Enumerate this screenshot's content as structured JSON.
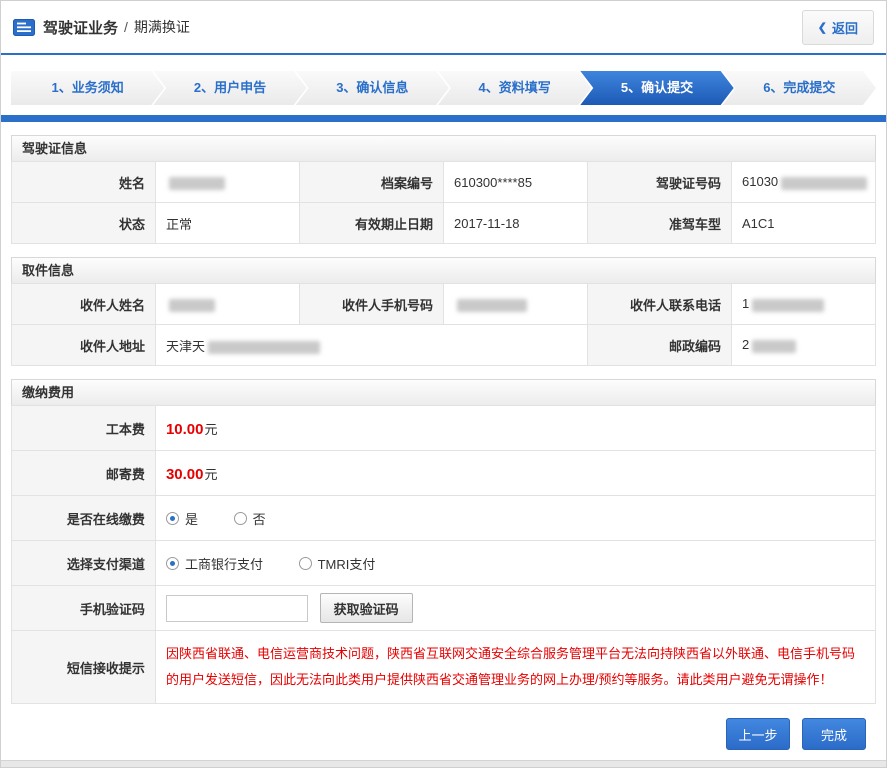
{
  "header": {
    "title_main": "驾驶证业务",
    "title_separator": "/",
    "title_sub": "期满换证",
    "back_chevron": "❮",
    "back_label": "返回"
  },
  "steps": {
    "active_index": 4,
    "items": [
      {
        "label": "1、业务须知"
      },
      {
        "label": "2、用户申告"
      },
      {
        "label": "3、确认信息"
      },
      {
        "label": "4、资料填写"
      },
      {
        "label": "5、确认提交"
      },
      {
        "label": "6、完成提交"
      }
    ]
  },
  "license_section": {
    "title": "驾驶证信息",
    "fields": {
      "name": {
        "label": "姓名",
        "value": "",
        "redacted": true
      },
      "file_number": {
        "label": "档案编号",
        "value": "610300****85"
      },
      "license_number": {
        "label": "驾驶证号码",
        "value": "61030",
        "redacted": true
      },
      "status": {
        "label": "状态",
        "value": "正常"
      },
      "valid_until": {
        "label": "有效期止日期",
        "value": "2017-11-18"
      },
      "vehicle_class": {
        "label": "准驾车型",
        "value": "A1C1"
      }
    }
  },
  "pickup_section": {
    "title": "取件信息",
    "fields": {
      "recipient_name": {
        "label": "收件人姓名",
        "value": "",
        "redacted": true
      },
      "recipient_mobile": {
        "label": "收件人手机号码",
        "value": "",
        "redacted": true
      },
      "recipient_phone": {
        "label": "收件人联系电话",
        "value": "1",
        "redacted": true
      },
      "recipient_address": {
        "label": "收件人地址",
        "value": "天津天",
        "redacted": true
      },
      "postal_code": {
        "label": "邮政编码",
        "value": "2",
        "redacted": true
      }
    }
  },
  "fee_section": {
    "title": "缴纳费用",
    "production_fee": {
      "label": "工本费",
      "amount": "10.00",
      "unit": "元"
    },
    "mailing_fee": {
      "label": "邮寄费",
      "amount": "30.00",
      "unit": "元"
    },
    "online_payment": {
      "label": "是否在线缴费",
      "selected_index": 0,
      "options": [
        {
          "label": "是"
        },
        {
          "label": "否"
        }
      ]
    },
    "payment_channel": {
      "label": "选择支付渠道",
      "selected_index": 0,
      "options": [
        {
          "label": "工商银行支付"
        },
        {
          "label": "TMRI支付"
        }
      ]
    },
    "verification": {
      "label": "手机验证码",
      "input_value": "",
      "button_label": "获取验证码"
    },
    "sms_notice": {
      "label": "短信接收提示",
      "text": "因陕西省联通、电信运营商技术问题，陕西省互联网交通安全综合服务管理平台无法向持陕西省以外联通、电信手机号码的用户发送短信，因此无法向此类用户提供陕西省交通管理业务的网上办理/预约等服务。请此类用户避免无谓操作！"
    }
  },
  "footer": {
    "prev_label": "上一步",
    "finish_label": "完成"
  },
  "colors": {
    "accent_blue": "#2a6fc9",
    "active_step_blue": "#1d5ab5",
    "alert_red": "#e60000"
  }
}
